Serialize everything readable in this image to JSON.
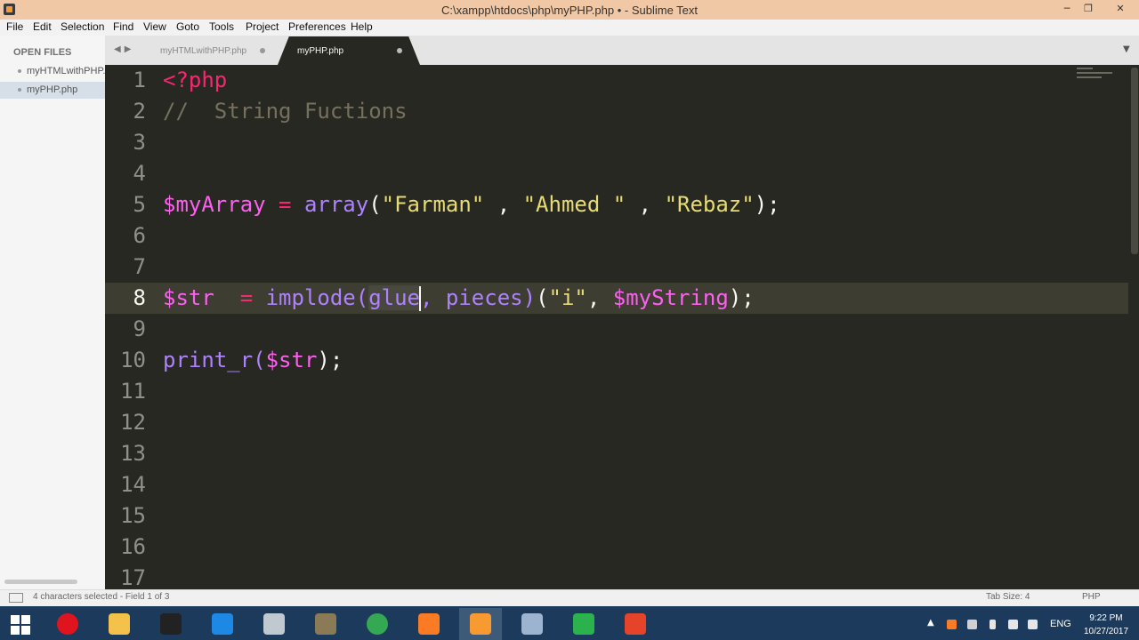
{
  "window": {
    "title": "C:\\xampp\\htdocs\\php\\myPHP.php • - Sublime Text",
    "minimize": "─",
    "restore": "❐",
    "close": "✕"
  },
  "menu": [
    "File",
    "Edit",
    "Selection",
    "Find",
    "View",
    "Goto",
    "Tools",
    "Project",
    "Preferences",
    "Help"
  ],
  "sidebar": {
    "heading": "OPEN FILES",
    "files": [
      "myHTMLwithPHP.php",
      "myPHP.php"
    ]
  },
  "tabs": [
    {
      "label": "myHTMLwithPHP.php",
      "active": false
    },
    {
      "label": "myPHP.php",
      "active": true
    }
  ],
  "tabbar": {
    "nav": "◀▶",
    "dropdown": "▼"
  },
  "editor": {
    "line_numbers": [
      "1",
      "2",
      "3",
      "4",
      "5",
      "6",
      "7",
      "8",
      "9",
      "10",
      "11",
      "12",
      "13",
      "14",
      "15",
      "16",
      "17"
    ],
    "active_line": "8",
    "code": {
      "l1": "<?php",
      "l2": "//  String Fuctions",
      "l5": {
        "var": "$myArray",
        "eq": " = ",
        "fn": "array",
        "open": "(",
        "s1": "\"Farman\"",
        "c1": " , ",
        "s2": "\"Ahmed \"",
        "c2": " , ",
        "s3": "\"Rebaz\"",
        "close": ");"
      },
      "l8": {
        "var": "$str",
        "eq": "  = ",
        "fn": "implode",
        "open": "(",
        "sel": "glue",
        "sep": ", ",
        "ph": "pieces",
        "close1": ")",
        "open2": "(",
        "s1": "\"i\"",
        "c1": ", ",
        "var2": "$myString",
        "close2": ");"
      },
      "l10": {
        "fn": "print_r",
        "open": "(",
        "var": "$str",
        "close": ");"
      }
    }
  },
  "status": {
    "text": "4 characters selected - Field 1 of 3",
    "tab_size": "Tab Size: 4",
    "syntax": "PHP"
  },
  "taskbar": {
    "apps": [
      {
        "name": "opera",
        "color": "#e0141e"
      },
      {
        "name": "file-explorer",
        "color": "#f4c24b"
      },
      {
        "name": "app-dark",
        "color": "#222222"
      },
      {
        "name": "outlook",
        "color": "#1e88e5"
      },
      {
        "name": "tool",
        "color": "#c0c8d0"
      },
      {
        "name": "gimp",
        "color": "#8a7a56"
      },
      {
        "name": "chrome",
        "color": "#34a853"
      },
      {
        "name": "xampp",
        "color": "#fb7a24"
      },
      {
        "name": "sublime-text",
        "color": "#f79a32"
      },
      {
        "name": "control-panel",
        "color": "#9db4d0"
      },
      {
        "name": "camtasia",
        "color": "#2bb24c"
      },
      {
        "name": "recorder",
        "color": "#e5432a"
      }
    ],
    "language": "ENG",
    "time": "9:22 PM",
    "date": "10/27/2017"
  }
}
